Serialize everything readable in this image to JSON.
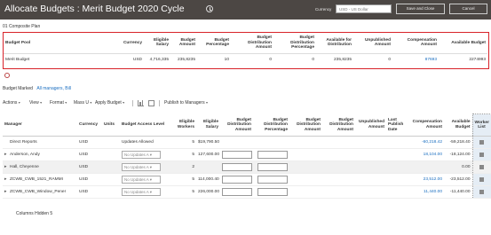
{
  "header": {
    "title": "Allocate Budgets : Merit Budget 2020 Cycle",
    "currency_label": "Currency",
    "currency_value": "USD - US Dollar",
    "save_close_label": "Save and Close",
    "cancel_label": "Cancel"
  },
  "composite_plan_label": "01 Composite Plan",
  "budget_pool": {
    "columns": [
      "Budget Pool",
      "Currency",
      "Eligible Salary",
      "Budget Amount",
      "Budget Percentage",
      "Budget Distribution Amount",
      "Budget Distribution Percentage",
      "Available for Distribution",
      "Unpublished Amount",
      "Compensation Amount",
      "Available Budget"
    ],
    "row": [
      "Merit Budget",
      "USD",
      "4,716,335",
      "235,8235",
      "10",
      "0",
      "0",
      "235,8235",
      "0",
      "87693",
      "2274993"
    ]
  },
  "budget_marked": {
    "label": "Budget Marked",
    "value": "All managers, Bill"
  },
  "toolbar": {
    "actions": "Actions",
    "view": "View",
    "format": "Format",
    "mass_update": "Mass U",
    "apply_budget": "Apply Budget",
    "publish": "Publish to Managers"
  },
  "grid": {
    "columns": [
      "Manager",
      "Currency",
      "Units",
      "Budget Access Level",
      "Eligible Workers",
      "Eligible Salary",
      "Budget Distribution Amount",
      "Budget Distribution Percentage",
      "Budget Distribution Amount",
      "Budget Distribution Amount",
      "Unpublished Amount",
      "Last Publish Date",
      "Compensation Amount",
      "Available Budget",
      "Worker List"
    ],
    "rows": [
      {
        "manager": "Direct Reports",
        "currency": "USD",
        "access": "Updates Allowed",
        "workers": "5",
        "salary": "$19,790.50",
        "comp": "-60,218.42",
        "available": "-59,218.40",
        "has_inputs": false,
        "has_select": false,
        "shaded": false,
        "expander": false
      },
      {
        "manager": "Anderson, Andy",
        "currency": "USD",
        "access": "No Updates A",
        "workers": "5",
        "salary": "127,600.00",
        "comp": "18,104.00",
        "available": "-18,124.00",
        "has_inputs": true,
        "has_select": true,
        "shaded": false,
        "expander": true
      },
      {
        "manager": "Hall, Cheyenne",
        "currency": "USD",
        "access": "No Updates A",
        "workers": "2",
        "salary": "",
        "comp": "",
        "available": "0.00",
        "has_inputs": true,
        "has_select": true,
        "shaded": true,
        "expander": true
      },
      {
        "manager": "ZCWB_CWB_1521_RAMMI",
        "currency": "USD",
        "access": "No Updates A",
        "workers": "5",
        "salary": "114,000.40",
        "comp": "23,512.00",
        "available": "-23,512.00",
        "has_inputs": true,
        "has_select": true,
        "shaded": false,
        "expander": true
      },
      {
        "manager": "ZCWB_CWB_Window_Pener",
        "currency": "USD",
        "access": "No Updates A",
        "workers": "5",
        "salary": "226,000.00",
        "comp": "11,440.00",
        "available": "-11,440.00",
        "has_inputs": true,
        "has_select": true,
        "shaded": false,
        "expander": true
      }
    ]
  },
  "footer": "Columns Hidden 5"
}
